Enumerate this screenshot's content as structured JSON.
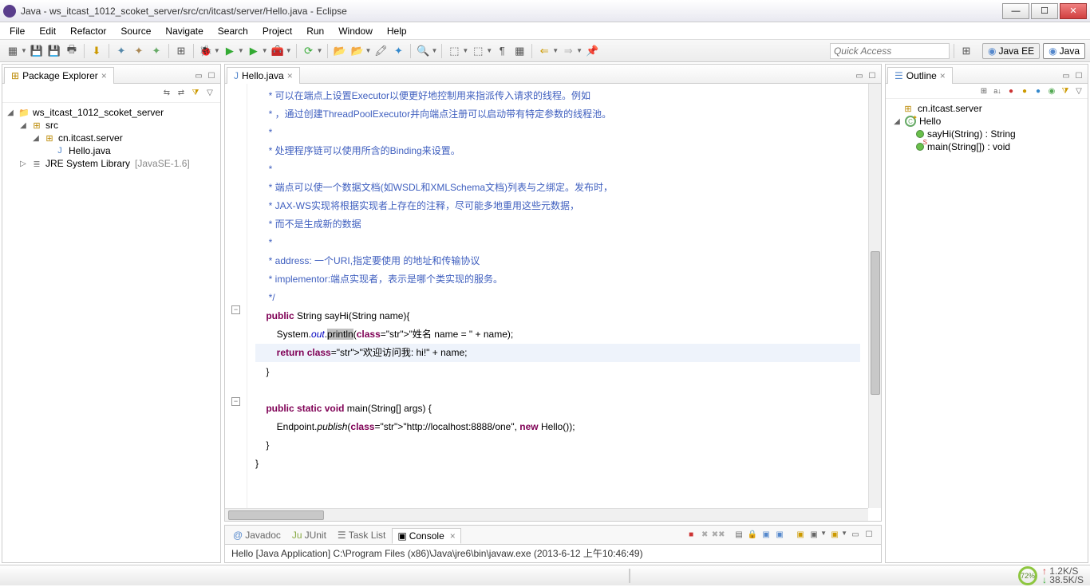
{
  "window": {
    "title": "Java - ws_itcast_1012_scoket_server/src/cn/itcast/server/Hello.java - Eclipse"
  },
  "menu": [
    "File",
    "Edit",
    "Refactor",
    "Source",
    "Navigate",
    "Search",
    "Project",
    "Run",
    "Window",
    "Help"
  ],
  "quick_access_placeholder": "Quick Access",
  "perspectives": [
    {
      "label": "Java EE",
      "active": false
    },
    {
      "label": "Java",
      "active": true
    }
  ],
  "package_explorer": {
    "title": "Package Explorer",
    "tree": {
      "project": "ws_itcast_1012_scoket_server",
      "src": "src",
      "pkg": "cn.itcast.server",
      "file": "Hello.java",
      "jre": "JRE System Library",
      "jre_suffix": "[JavaSE-1.6]"
    }
  },
  "editor": {
    "tab": "Hello.java",
    "code_lines": [
      "     * 可以在端点上设置Executor以便更好地控制用来指派传入请求的线程。例如",
      "     * ，通过创建ThreadPoolExecutor并向端点注册可以启动带有特定参数的线程池。",
      "     *",
      "     * 处理程序链可以使用所含的Binding来设置。",
      "     *",
      "     * 端点可以使一个数据文档(如WSDL和XMLSchema文档)列表与之绑定。发布时，",
      "     * JAX-WS实现将根据实现者上存在的注释，尽可能多地重用这些元数据，",
      "     * 而不是生成新的数据",
      "     *",
      "     * address: 一个URI,指定要使用 的地址和传输协议",
      "     * implementor:端点实现者，表示是哪个类实现的服务。",
      "     */",
      "    public String sayHi(String name){",
      "        System.out.println(\"姓名 name = \" + name);",
      "        return \"欢迎访问我: hi!\" + name;",
      "    }",
      "    ",
      "    public static void main(String[] args) {",
      "        Endpoint.publish(\"http://localhost:8888/one\", new Hello());",
      "    }",
      "}"
    ]
  },
  "outline": {
    "title": "Outline",
    "pkg": "cn.itcast.server",
    "cls": "Hello",
    "m1": "sayHi(String) : String",
    "m2": "main(String[]) : void"
  },
  "bottom": {
    "tabs": [
      {
        "label": "Javadoc",
        "prefix": "@"
      },
      {
        "label": "JUnit",
        "prefix": "Ju"
      },
      {
        "label": "Task List",
        "prefix": "☰"
      },
      {
        "label": "Console",
        "prefix": "▣",
        "active": true
      }
    ],
    "console_line": "Hello [Java Application] C:\\Program Files (x86)\\Java\\jre6\\bin\\javaw.exe (2013-6-12 上午10:46:49)"
  },
  "status": {
    "pct": "72%",
    "up": "1.2K/S",
    "down": "38.5K/S"
  }
}
